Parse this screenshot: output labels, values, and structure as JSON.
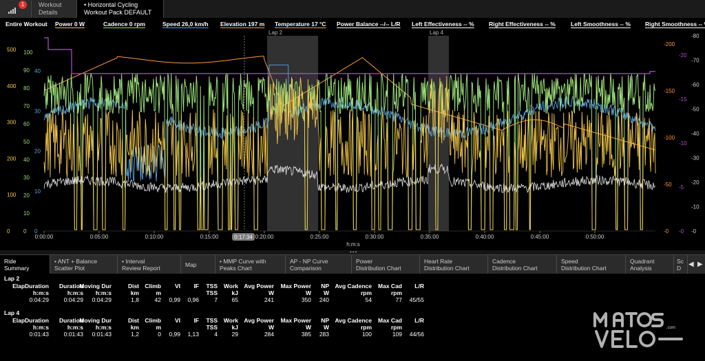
{
  "topbar": {
    "notification_count": "1",
    "tabs": [
      {
        "line1": "Workout",
        "line2": "Details"
      },
      {
        "line1": "• Horizontal Cycling",
        "line2": "Workout Pack DEFAULT"
      }
    ]
  },
  "metrics": {
    "entire_workout": "Entire Workout",
    "items": [
      {
        "label": "Power  0 W",
        "color": "#f3c94b"
      },
      {
        "label": "Cadence  0 rpm",
        "color": "#9ddf7a"
      },
      {
        "label": "Speed  26,0 km/h",
        "color": "#5aa3e6"
      },
      {
        "label": "Elevation  197 m",
        "color": "#ff9a3c"
      },
      {
        "label": "Temperature  17 °C",
        "color": "#ff9a3c"
      },
      {
        "label": "Power Balance  --/-- L/R",
        "color": "#ffffff"
      },
      {
        "label": "Left Effectiveness  -- %",
        "color": "#ffffff"
      },
      {
        "label": "Right Effectiveness  -- %",
        "color": "#ffffff"
      },
      {
        "label": "Left Smoothness  -- %",
        "color": "#ffffff"
      },
      {
        "label": "Right Smoothness  -- %",
        "color": "#ffffff"
      }
    ]
  },
  "chart_data": {
    "type": "line",
    "xlabel": "h:m:s",
    "x_ticks": [
      "0:00:00",
      "0:05:00",
      "0:10:00",
      "0:15:00",
      "0:20:00",
      "0:25:00",
      "0:30:00",
      "0:35:00",
      "0:40:00",
      "0:45:00",
      "0:50:00"
    ],
    "cursor_label": "0:17:34",
    "lap_labels": [
      "Lap 2",
      "Lap 4"
    ],
    "axes": {
      "power_ticks": [
        "500",
        "400",
        "300",
        "200",
        "100",
        "0"
      ],
      "cadence_ticks": [
        "100",
        "90",
        "80",
        "70",
        "60",
        "50",
        "40",
        "30",
        "20",
        "10",
        "0"
      ],
      "speed_ticks": [
        "40",
        "30",
        "20",
        "10",
        "0"
      ],
      "elevation_ticks": [
        "-200",
        "-150",
        "-100",
        "-50",
        "-0"
      ],
      "temperature_ticks": [
        "-20",
        "-15",
        "-10",
        "-5",
        "-0"
      ],
      "balance_ticks": [
        "-80",
        "-70",
        "-60",
        "-50",
        "-40",
        "-30",
        "-20",
        "-10",
        "-0"
      ]
    },
    "series": [
      {
        "name": "Power",
        "color": "#f3c94b"
      },
      {
        "name": "Cadence",
        "color": "#9ddf7a"
      },
      {
        "name": "Speed",
        "color": "#5aa3e6"
      },
      {
        "name": "Elevation",
        "color": "#ff9a3c"
      },
      {
        "name": "Temperature",
        "color": "#b14fd1"
      }
    ]
  },
  "bottom_tabs": [
    {
      "line1": "Ride",
      "line2": "Summary"
    },
    {
      "line1": "• ANT + Balance",
      "line2": "Scatter Plot"
    },
    {
      "line1": "• Interval",
      "line2": "Review Report"
    },
    {
      "line1": "Map",
      "line2": ""
    },
    {
      "line1": "• MMP Curve with",
      "line2": "Peaks Chart"
    },
    {
      "line1": "AP - NP Curve",
      "line2": "Comparison"
    },
    {
      "line1": "Power",
      "line2": "Distribution Chart"
    },
    {
      "line1": "Heart Rate",
      "line2": "Distribution Chart"
    },
    {
      "line1": "Cadence",
      "line2": "Distribution Chart"
    },
    {
      "line1": "Speed",
      "line2": "Distribution Chart"
    },
    {
      "line1": "Quadrant",
      "line2": "Analysis"
    },
    {
      "line1": "Sc",
      "line2": "D"
    }
  ],
  "summary": {
    "columns": [
      {
        "h1": "ElapDuration",
        "h2": "h:m:s"
      },
      {
        "h1": "Duration",
        "h2": "h:m:s"
      },
      {
        "h1": "Moving Dur",
        "h2": "h:m:s"
      },
      {
        "h1": "Dist",
        "h2": "km"
      },
      {
        "h1": "Climb",
        "h2": "m"
      },
      {
        "h1": "VI",
        "h2": ""
      },
      {
        "h1": "IF",
        "h2": ""
      },
      {
        "h1": "TSS",
        "h2": "TSS"
      },
      {
        "h1": "Work",
        "h2": "kJ"
      },
      {
        "h1": "Avg Power",
        "h2": "W"
      },
      {
        "h1": "Max Power",
        "h2": "W"
      },
      {
        "h1": "NP",
        "h2": "W"
      },
      {
        "h1": "Avg Cadence",
        "h2": "rpm"
      },
      {
        "h1": "Max Cad",
        "h2": "rpm"
      },
      {
        "h1": "L/R",
        "h2": ""
      }
    ],
    "laps": [
      {
        "title": "Lap 2",
        "values": [
          "0:04:29",
          "0:04:29",
          "0:04:29",
          "1,8",
          "42",
          "0,99",
          "0,96",
          "7",
          "65",
          "241",
          "350",
          "240",
          "54",
          "77",
          "45/55"
        ]
      },
      {
        "title": "Lap 4",
        "values": [
          "0:01:43",
          "0:01:43",
          "0:01:43",
          "1,2",
          "0",
          "0,99",
          "1,13",
          "4",
          "29",
          "284",
          "385",
          "283",
          "100",
          "109",
          "44/56"
        ]
      }
    ]
  },
  "watermark": {
    "text": "matos vélo"
  }
}
